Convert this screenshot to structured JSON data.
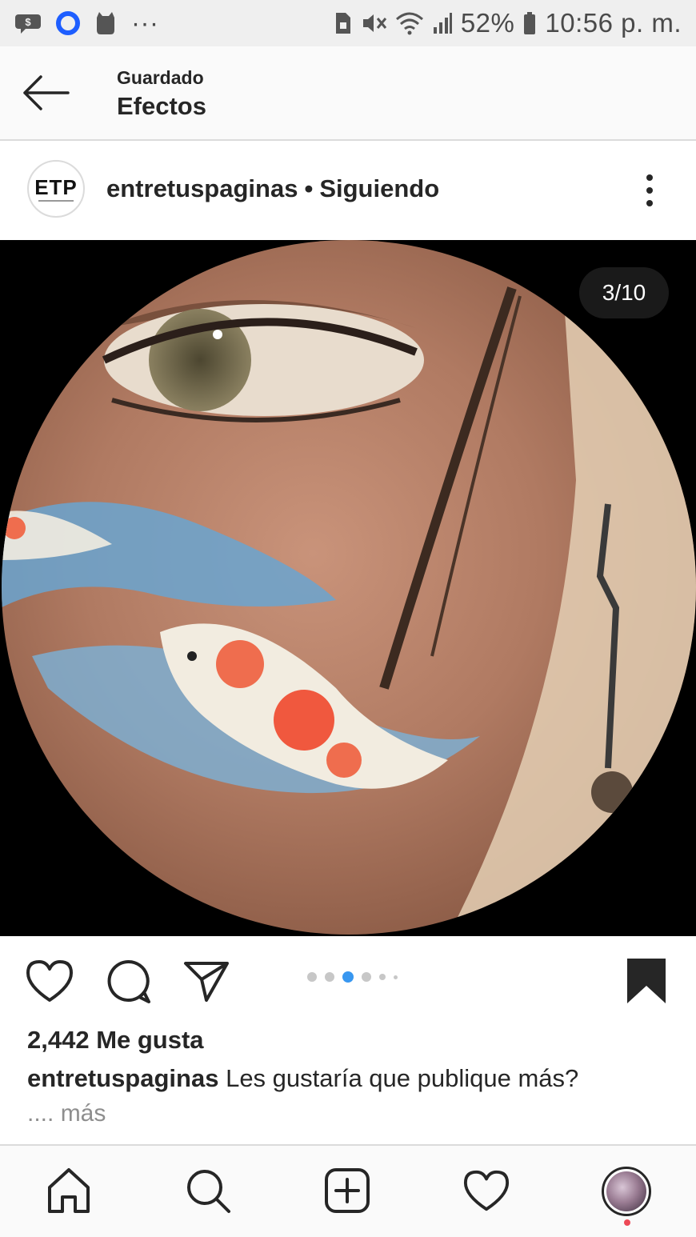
{
  "status_bar": {
    "battery_percent": "52%",
    "time": "10:56 p. m.",
    "more_indicator": "···",
    "icons": [
      "message-icon",
      "circle-app-icon",
      "cat-app-icon",
      "sim-lock-icon",
      "mute-icon",
      "wifi-icon",
      "signal-icon",
      "battery-icon"
    ]
  },
  "header": {
    "subtitle": "Guardado",
    "title": "Efectos"
  },
  "post": {
    "avatar_text": "ETP",
    "username": "entretuspaginas",
    "separator": "•",
    "follow_status": "Siguiendo",
    "counter": "3/10",
    "carousel_index": 3,
    "carousel_total": 10,
    "likes": "2,442 Me gusta",
    "caption_user": "entretuspaginas",
    "caption_text": "Les gustaría que publique más?",
    "more_prefix": "....",
    "more_label": "más"
  },
  "colors": {
    "accent_blue": "#3897f0",
    "text": "#262626",
    "muted": "#8e8e8e",
    "notification": "#ed4956"
  },
  "nav": {
    "items": [
      "home-icon",
      "search-icon",
      "add-icon",
      "heart-icon",
      "profile-avatar"
    ]
  }
}
